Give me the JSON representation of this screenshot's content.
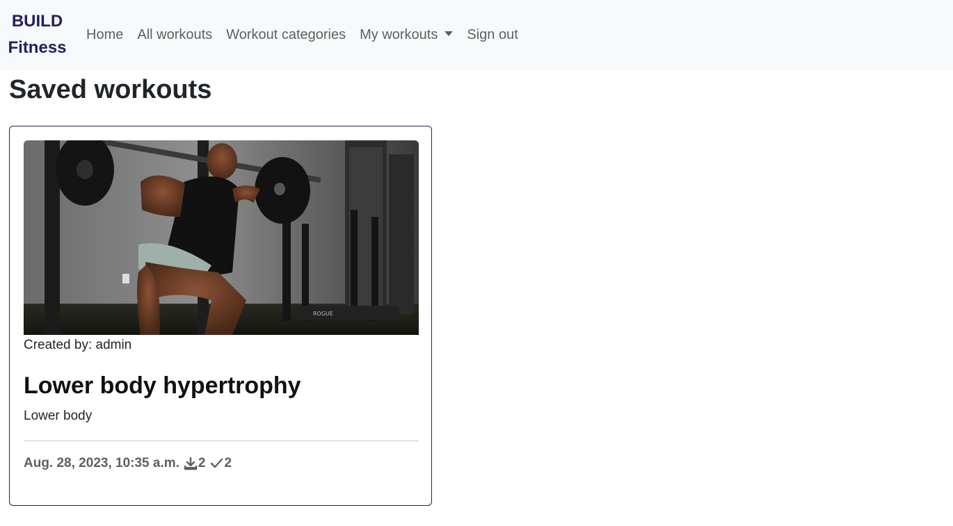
{
  "nav": {
    "brand_line1": "BUILD",
    "brand_line2": "Fitness",
    "brand_color": "#222060",
    "links": [
      "Home",
      "All workouts",
      "Workout categories",
      "My workouts",
      "Sign out"
    ]
  },
  "page": {
    "title": "Saved workouts"
  },
  "card": {
    "image_alt": "man doing barbell squat in gym",
    "created_by": "Created by: admin",
    "title": "Lower body hypertrophy",
    "category": "Lower body",
    "date": "Aug. 28, 2023, 10:35 a.m.",
    "downloads_icon": "download-icon",
    "downloads_count": "2",
    "completed_icon": "check-icon",
    "completed_count": "2",
    "border_color": "#222060"
  }
}
